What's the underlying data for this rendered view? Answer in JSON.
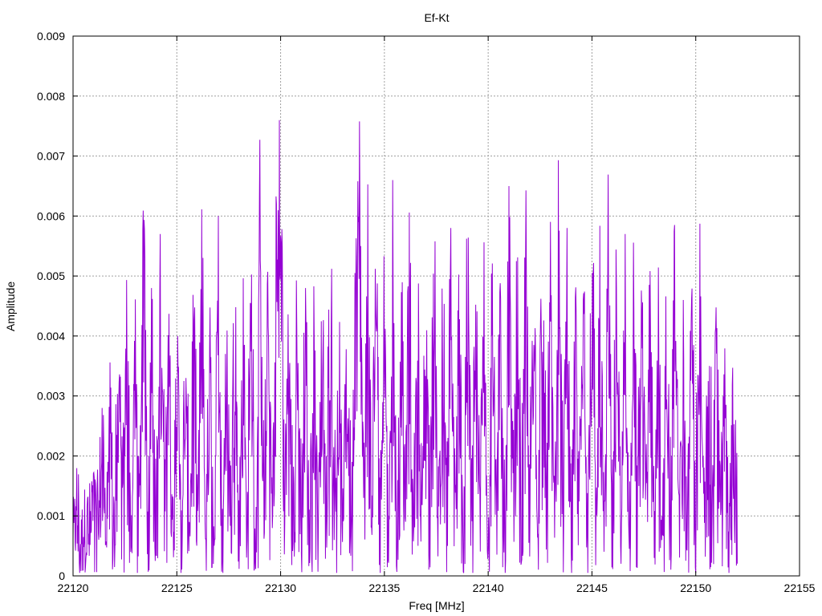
{
  "chart_data": {
    "type": "line",
    "title": "Ef-Kt",
    "xlabel": "Freq [MHz]",
    "ylabel": "Amplitude",
    "xlim": [
      22120,
      22155
    ],
    "ylim": [
      0,
      0.009
    ],
    "x_ticks": [
      "22120",
      "22125",
      "22130",
      "22135",
      "22140",
      "22145",
      "22150",
      "22155"
    ],
    "y_ticks": [
      "0",
      "0.001",
      "0.002",
      "0.003",
      "0.004",
      "0.005",
      "0.006",
      "0.007",
      "0.008",
      "0.009"
    ],
    "grid": true,
    "legend": "none",
    "series": [
      {
        "color": "#9400d3",
        "x_start": 22120,
        "x_end": 22152,
        "description_points": [
          [
            22120.0,
            0.0006
          ],
          [
            22120.2,
            0.0014
          ],
          [
            22120.4,
            0.0004
          ],
          [
            22120.6,
            0.0017
          ],
          [
            22120.8,
            0.0009
          ],
          [
            22121.0,
            0.0018
          ],
          [
            22121.2,
            0.0006
          ],
          [
            22121.4,
            0.0028
          ],
          [
            22121.6,
            0.0009
          ],
          [
            22121.8,
            0.0034
          ],
          [
            22122.0,
            0.0008
          ],
          [
            22122.2,
            0.0039
          ],
          [
            22122.4,
            0.0012
          ],
          [
            22122.6,
            0.0049
          ],
          [
            22122.8,
            0.0005
          ],
          [
            22123.0,
            0.0042
          ],
          [
            22123.2,
            0.0009
          ],
          [
            22123.4,
            0.007
          ],
          [
            22123.6,
            0.0012
          ],
          [
            22123.8,
            0.0052
          ],
          [
            22124.0,
            0.0006
          ],
          [
            22124.2,
            0.0057
          ],
          [
            22124.4,
            0.0015
          ],
          [
            22124.6,
            0.0048
          ],
          [
            22124.8,
            0.0005
          ],
          [
            22125.0,
            0.0047
          ],
          [
            22125.2,
            0.0012
          ],
          [
            22125.4,
            0.0038
          ],
          [
            22125.6,
            0.0009
          ],
          [
            22125.8,
            0.0052
          ],
          [
            22126.0,
            0.0007
          ],
          [
            22126.2,
            0.0058
          ],
          [
            22126.4,
            0.0011
          ],
          [
            22126.6,
            0.0041
          ],
          [
            22126.8,
            0.0003
          ],
          [
            22127.0,
            0.006
          ],
          [
            22127.2,
            0.0009
          ],
          [
            22127.4,
            0.0044
          ],
          [
            22127.6,
            0.0013
          ],
          [
            22127.8,
            0.0054
          ],
          [
            22128.0,
            0.0008
          ],
          [
            22128.2,
            0.0049
          ],
          [
            22128.4,
            0.0014
          ],
          [
            22128.6,
            0.0059
          ],
          [
            22128.8,
            0.0006
          ],
          [
            22129.0,
            0.0061
          ],
          [
            22129.2,
            0.0012
          ],
          [
            22129.4,
            0.0055
          ],
          [
            22129.6,
            0.001
          ],
          [
            22129.8,
            0.0062
          ],
          [
            22130.0,
            0.0082
          ],
          [
            22130.2,
            0.0014
          ],
          [
            22130.4,
            0.0051
          ],
          [
            22130.6,
            0.0008
          ],
          [
            22130.8,
            0.0045
          ],
          [
            22131.0,
            0.0011
          ],
          [
            22131.2,
            0.0048
          ],
          [
            22131.4,
            0.0007
          ],
          [
            22131.6,
            0.0042
          ],
          [
            22131.8,
            0.0013
          ],
          [
            22132.0,
            0.0045
          ],
          [
            22132.2,
            0.0009
          ],
          [
            22132.4,
            0.0068
          ],
          [
            22132.6,
            0.0012
          ],
          [
            22132.8,
            0.0039
          ],
          [
            22133.0,
            0.0005
          ],
          [
            22133.2,
            0.0046
          ],
          [
            22133.4,
            0.001
          ],
          [
            22133.6,
            0.0055
          ],
          [
            22133.8,
            0.0073
          ],
          [
            22134.0,
            0.0013
          ],
          [
            22134.2,
            0.0061
          ],
          [
            22134.4,
            0.0008
          ],
          [
            22134.6,
            0.0062
          ],
          [
            22134.8,
            0.0011
          ],
          [
            22135.0,
            0.0058
          ],
          [
            22135.2,
            0.0003
          ],
          [
            22135.4,
            0.0066
          ],
          [
            22135.6,
            0.001
          ],
          [
            22135.8,
            0.0051
          ],
          [
            22136.0,
            0.0014
          ],
          [
            22136.2,
            0.0055
          ],
          [
            22136.4,
            0.0009
          ],
          [
            22136.6,
            0.0049
          ],
          [
            22136.8,
            0.0012
          ],
          [
            22137.0,
            0.0044
          ],
          [
            22137.2,
            0.0016
          ],
          [
            22137.4,
            0.0059
          ],
          [
            22137.6,
            0.0011
          ],
          [
            22137.8,
            0.0052
          ],
          [
            22138.0,
            0.0008
          ],
          [
            22138.2,
            0.0058
          ],
          [
            22138.4,
            0.0013
          ],
          [
            22138.6,
            0.0047
          ],
          [
            22138.8,
            0.0005
          ],
          [
            22139.0,
            0.0068
          ],
          [
            22139.2,
            0.001
          ],
          [
            22139.4,
            0.0057
          ],
          [
            22139.6,
            0.0014
          ],
          [
            22139.8,
            0.0051
          ],
          [
            22140.0,
            0.0004
          ],
          [
            22140.2,
            0.0062
          ],
          [
            22140.4,
            0.0011
          ],
          [
            22140.6,
            0.0053
          ],
          [
            22140.8,
            0.0003
          ],
          [
            22141.0,
            0.0065
          ],
          [
            22141.2,
            0.0012
          ],
          [
            22141.4,
            0.0058
          ],
          [
            22141.6,
            0.0009
          ],
          [
            22141.8,
            0.006
          ],
          [
            22142.0,
            0.0014
          ],
          [
            22142.2,
            0.0056
          ],
          [
            22142.4,
            0.0007
          ],
          [
            22142.6,
            0.0063
          ],
          [
            22142.8,
            0.0012
          ],
          [
            22143.0,
            0.0054
          ],
          [
            22143.2,
            0.0009
          ],
          [
            22143.4,
            0.0076
          ],
          [
            22143.6,
            0.0011
          ],
          [
            22143.8,
            0.0058
          ],
          [
            22144.0,
            0.0006
          ],
          [
            22144.2,
            0.0052
          ],
          [
            22144.4,
            0.0013
          ],
          [
            22144.6,
            0.0057
          ],
          [
            22144.8,
            0.0009
          ],
          [
            22145.0,
            0.0067
          ],
          [
            22145.2,
            0.0012
          ],
          [
            22145.4,
            0.0055
          ],
          [
            22145.6,
            0.0007
          ],
          [
            22145.8,
            0.0061
          ],
          [
            22146.0,
            0.0013
          ],
          [
            22146.2,
            0.0052
          ],
          [
            22146.4,
            0.001
          ],
          [
            22146.6,
            0.0057
          ],
          [
            22146.8,
            0.0005
          ],
          [
            22147.0,
            0.0048
          ],
          [
            22147.2,
            0.0011
          ],
          [
            22147.4,
            0.0055
          ],
          [
            22147.6,
            0.0008
          ],
          [
            22147.8,
            0.0052
          ],
          [
            22148.0,
            0.0003
          ],
          [
            22148.2,
            0.005
          ],
          [
            22148.4,
            0.0013
          ],
          [
            22148.6,
            0.0055
          ],
          [
            22148.8,
            0.0009
          ],
          [
            22149.0,
            0.0064
          ],
          [
            22149.2,
            0.0012
          ],
          [
            22149.4,
            0.0046
          ],
          [
            22149.6,
            0.0004
          ],
          [
            22149.8,
            0.0052
          ],
          [
            22150.0,
            0.0011
          ],
          [
            22150.2,
            0.0056
          ],
          [
            22150.4,
            0.0009
          ],
          [
            22150.6,
            0.0044
          ],
          [
            22150.8,
            0.0014
          ],
          [
            22151.0,
            0.0052
          ],
          [
            22151.2,
            0.0008
          ],
          [
            22151.4,
            0.004
          ],
          [
            22151.6,
            0.0005
          ],
          [
            22151.8,
            0.0038
          ],
          [
            22152.0,
            0.0018
          ]
        ]
      }
    ]
  }
}
